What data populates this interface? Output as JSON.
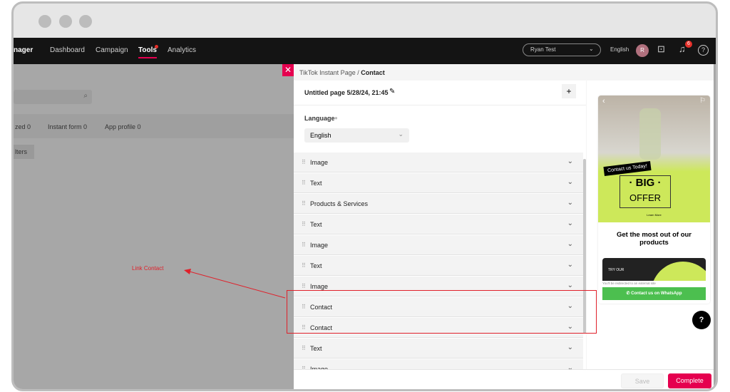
{
  "nav": {
    "brand": "nager",
    "items": [
      "Dashboard",
      "Campaign",
      "Tools",
      "Analytics"
    ],
    "active": "Tools",
    "account": "Ryan Test",
    "language": "English",
    "avatar": "R",
    "notifications": "6"
  },
  "background": {
    "tabs": [
      "zed 0",
      "Instant form 0",
      "App profile 0"
    ],
    "filters": "lters"
  },
  "drawer": {
    "breadcrumb_parent": "TikTok Instant Page",
    "breadcrumb_sep": "/",
    "breadcrumb_current": "Contact",
    "page_title": "Untitled page 5/28/24, 21:45",
    "language_label": "Language",
    "language_value": "English",
    "components": [
      "Image",
      "Text",
      "Products & Services",
      "Text",
      "Image",
      "Text",
      "Image",
      "Contact",
      "Contact",
      "Text",
      "Image"
    ],
    "save": "Save",
    "complete": "Complete"
  },
  "preview": {
    "badge": "Contact us Today!",
    "big": "· BIG ·",
    "offer": "OFFER",
    "learn": "Learn More",
    "heading": "Get the most out of our products",
    "card": "TRY OUR",
    "redirect": "You'll be redirected to an external site",
    "whatsapp": "Contact us on WhatsApp"
  },
  "annotation": {
    "label": "Link Contact",
    "color": "#e0202a"
  },
  "colors": {
    "accent": "#e5004f",
    "whatsapp": "#4cbf4f",
    "offer_bg": "#cde85a"
  }
}
